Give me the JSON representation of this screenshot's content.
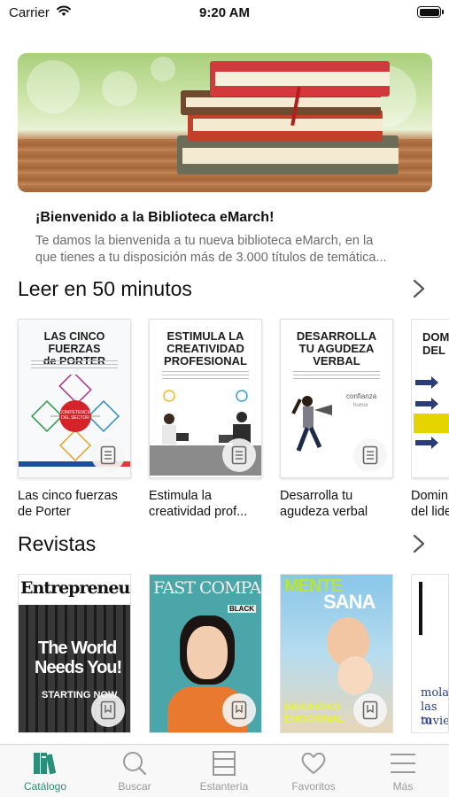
{
  "status_bar": {
    "carrier": "Carrier",
    "time": "9:20 AM"
  },
  "welcome": {
    "title": "¡Bienvenido a la Biblioteca eMarch!",
    "body_line1": "Te damos la bienvenida a tu nueva biblioteca eMarch, en la",
    "body_line2": "que tienes a tu disposición más de 3.000 títulos de temática..."
  },
  "sections": {
    "books_title": "Leer en 50 minutos",
    "magazines_title": "Revistas"
  },
  "books": [
    {
      "cover_title": "LAS CINCO FUERZAS\nde PORTER",
      "label_line1": "Las cinco fuerzas",
      "label_line2": "de Porter"
    },
    {
      "cover_title": "ESTIMULA LA\nCREATIVIDAD\nPROFESIONAL",
      "label_line1": "Estimula la",
      "label_line2": "creatividad prof..."
    },
    {
      "cover_title": "DESARROLLA\nTU AGUDEZA\nVERBAL",
      "label_line1": "Desarrolla tu",
      "label_line2": "agudeza verbal"
    },
    {
      "cover_title": "DOM\nDEL",
      "label_line1": "Domin",
      "label_line2": "del lide"
    }
  ],
  "book_diagram": {
    "center": "COMPETENCIA\nDEL SECTOR"
  },
  "verbal_words": {
    "w1": "confianza",
    "w2": "humor"
  },
  "magazines": [
    {
      "masthead": "Entrepreneur",
      "headline1": "The World",
      "headline2": "Needs You!",
      "kicker": "STARTING NOW"
    },
    {
      "masthead": "FAST COMPANY",
      "sub": "BLACK"
    },
    {
      "masthead1": "MENTE",
      "masthead2": "SANA",
      "cover_line": "INMUNIDAD",
      "cover_line2": "EMOCIONAL"
    },
    {
      "line1": "molar",
      "line2": "las m",
      "line3": "tuvier"
    }
  ],
  "tabs": [
    {
      "label": "Catálogo",
      "icon": "books-icon",
      "active": true
    },
    {
      "label": "Buscar",
      "icon": "search-icon",
      "active": false
    },
    {
      "label": "Estantería",
      "icon": "shelf-icon",
      "active": false
    },
    {
      "label": "Favoritos",
      "icon": "heart-icon",
      "active": false
    },
    {
      "label": "Más",
      "icon": "menu-icon",
      "active": false
    }
  ],
  "colors": {
    "accent": "#2a8e78",
    "inactive": "#9a9a9a"
  }
}
